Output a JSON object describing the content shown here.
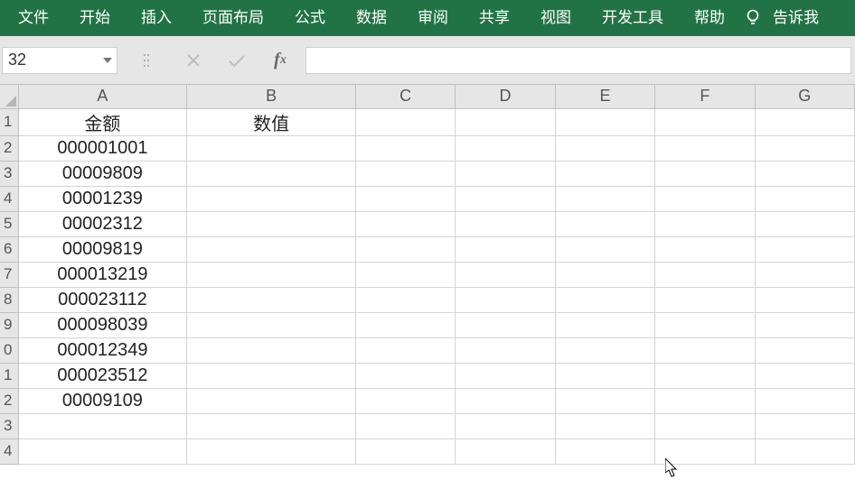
{
  "ribbon": {
    "tabs": [
      "文件",
      "开始",
      "插入",
      "页面布局",
      "公式",
      "数据",
      "审阅",
      "共享",
      "视图",
      "开发工具",
      "帮助"
    ],
    "tell_me": "告诉我"
  },
  "name_box": "32",
  "formula_bar": "",
  "columns": [
    "A",
    "B",
    "C",
    "D",
    "E",
    "F",
    "G"
  ],
  "row_headers": [
    "1",
    "2",
    "3",
    "4",
    "5",
    "6",
    "7",
    "8",
    "9",
    "0",
    "1",
    "2",
    "3",
    "4"
  ],
  "cells": {
    "A1": "金额",
    "B1": "数值",
    "A2": "000001001",
    "A3": "00009809",
    "A4": "00001239",
    "A5": "00002312",
    "A6": "00009819",
    "A7": "000013219",
    "A8": "000023112",
    "A9": "000098039",
    "A10": "000012349",
    "A11": "000023512",
    "A12": "00009109"
  }
}
